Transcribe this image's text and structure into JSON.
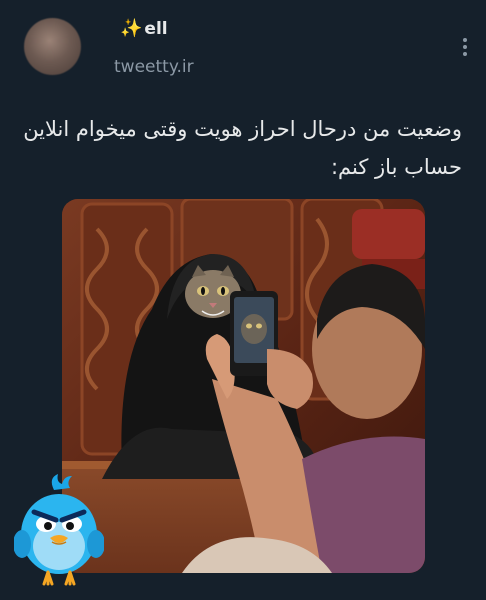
{
  "tweet": {
    "author_name": "ell",
    "author_prefix_icon": "sparkles-icon",
    "handle": "tweetty.ir",
    "text": "وضعیت من درحال احراز هویت وقتی میخوام انلاین حساب باز کنم:"
  },
  "icons": {
    "more": "more-vertical-icon",
    "mascot": "angry-blue-bird-mascot"
  },
  "colors": {
    "background": "#15202b",
    "text": "#e7e9ea",
    "muted": "#8b98a5",
    "accent": "#f5c518"
  }
}
